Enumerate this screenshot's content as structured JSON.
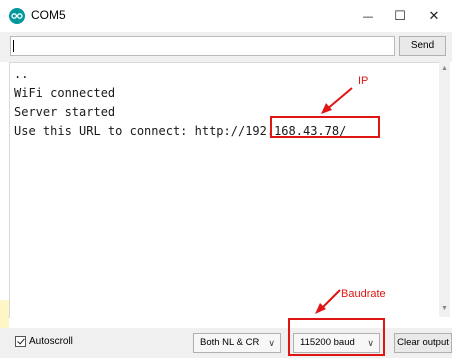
{
  "window": {
    "title": "COM5",
    "minimize": "—",
    "maximize": "☐",
    "close": "✕"
  },
  "send_row": {
    "input_value": "",
    "send_label": "Send"
  },
  "output": {
    "lines": [
      "..",
      "WiFi connected",
      "Server started",
      "Use this URL to connect: http://192.168.43.78/"
    ]
  },
  "annotations": {
    "ip_label": "IP",
    "baudrate_label": "Baudrate",
    "color": "#e01515"
  },
  "bottom_bar": {
    "autoscroll_label": "Autoscroll",
    "autoscroll_checked": true,
    "line_ending": "Both NL & CR",
    "baud_rate": "115200 baud",
    "clear_label": "Clear output"
  },
  "icons": {
    "app": "arduino-icon",
    "dropdown": "chevron-down-icon"
  }
}
